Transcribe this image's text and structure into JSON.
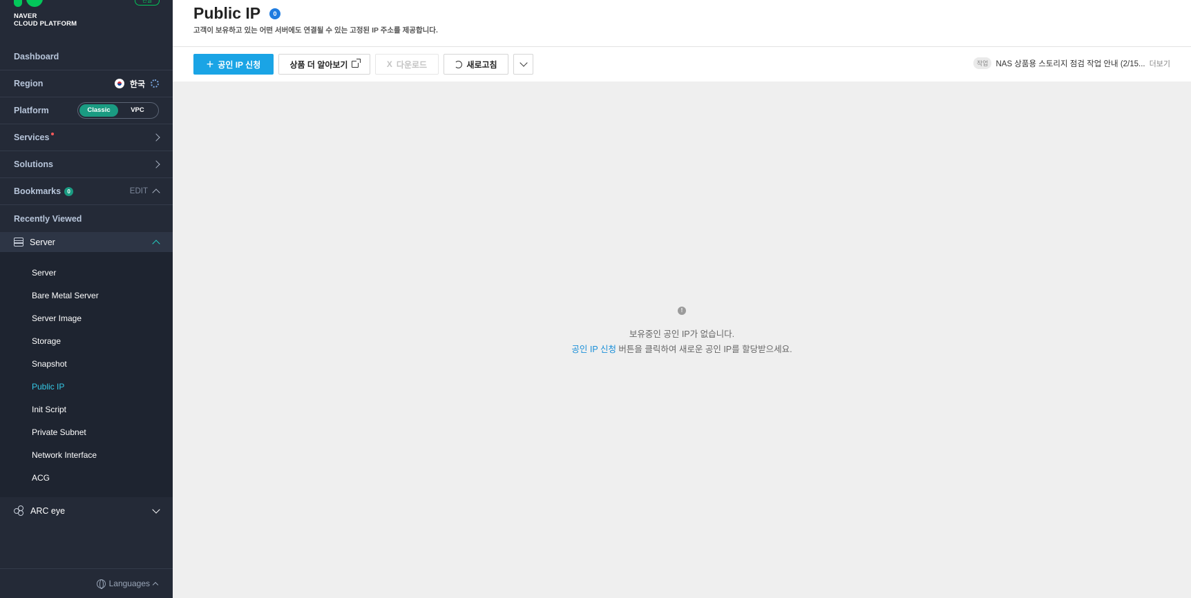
{
  "brand": {
    "line1": "NAVER",
    "line2": "CLOUD PLATFORM",
    "badge": "한글"
  },
  "sidebar": {
    "dashboard": "Dashboard",
    "region": {
      "label": "Region",
      "value": "한국"
    },
    "platform": {
      "label": "Platform",
      "options": [
        "Classic",
        "VPC"
      ],
      "selected": "Classic"
    },
    "services": "Services",
    "solutions": "Solutions",
    "bookmarks": {
      "label": "Bookmarks",
      "count": "0",
      "edit": "EDIT"
    },
    "recently_viewed": "Recently Viewed",
    "server_group": "Server",
    "server_items": [
      "Server",
      "Bare Metal Server",
      "Server Image",
      "Storage",
      "Snapshot",
      "Public IP",
      "Init Script",
      "Private Subnet",
      "Network Interface",
      "ACG"
    ],
    "active_item": "Public IP",
    "arc_eye": "ARC eye",
    "languages": "Languages"
  },
  "header": {
    "title": "Public IP",
    "count": "0",
    "description": "고객이 보유하고 있는 어떤 서버에도 연결될 수 있는 고정된 IP 주소를 제공합니다."
  },
  "toolbar": {
    "request": "공인 IP 신청",
    "learn_more": "상품 더 알아보기",
    "download": "다운로드",
    "refresh": "새로고침"
  },
  "notice": {
    "tag": "작업",
    "text": "NAS 상품용 스토리지 점검 작업 안내 (2/15...",
    "more": "더보기"
  },
  "empty": {
    "line1": "보유중인 공인 IP가 없습니다.",
    "link": "공인 IP 신청",
    "line2_rest": " 버튼을 클릭하여 새로운 공인 IP를 할당받으세요."
  },
  "colors": {
    "sidebar_bg": "#242a37",
    "primary": "#1aa4e5",
    "active_menu": "#35c9e6",
    "brand_green": "#03c75a"
  }
}
